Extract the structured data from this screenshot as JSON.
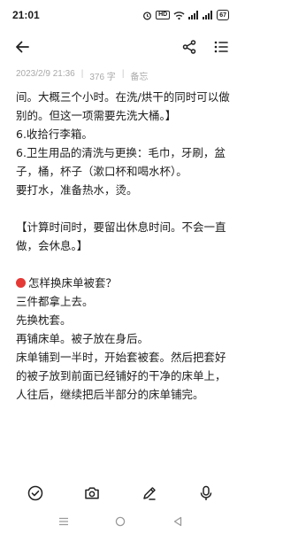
{
  "status_bar": {
    "time": "21:01",
    "hd_label": "HD",
    "battery_level": "67"
  },
  "note": {
    "date": "2023/2/9 21:36",
    "word_count": "376 字",
    "category": "备忘",
    "lines": [
      "间。大概三个小时。在洗/烘干的同时可以做",
      "别的。但这一项需要先洗大桶。】",
      "6.收拾行李箱。",
      "6.卫生用品的清洗与更换：毛巾，牙刷，盆",
      "子，桶，杯子（漱口杯和喝水杯）。",
      "要打水，准备热水，烫。",
      "",
      "【计算时间时，要留出休息时间。不会一直",
      "做，会休息。】",
      "",
      "怎样换床单被套？",
      "三件都拿上去。",
      "先换枕套。",
      "再铺床单。被子放在身后。",
      "床单铺到一半时，开始套被套。然后把套好",
      "的被子放到前面已经铺好的干净的床单上，",
      "人往后，继续把后半部分的床单铺完。"
    ]
  },
  "colors": {
    "accent_red": "#e53935",
    "meta_gray": "#a9a9a9"
  },
  "icons": {
    "toolbar": [
      "back-arrow-icon",
      "share-icon",
      "more-icon"
    ],
    "bottom": [
      "checklist-icon",
      "camera-icon",
      "pen-icon",
      "microphone-icon"
    ],
    "nav": [
      "menu-icon",
      "home-icon",
      "back-icon"
    ]
  }
}
